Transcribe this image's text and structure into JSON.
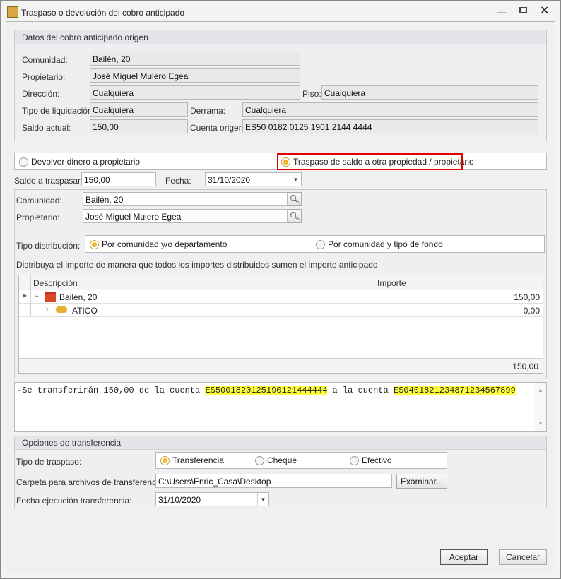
{
  "window": {
    "title": "Traspaso o devolución del cobro anticipado"
  },
  "origin": {
    "header": "Datos del cobro anticipado origen",
    "comunidad_label": "Comunidad:",
    "comunidad": "Bailén, 20",
    "propietario_label": "Propietario:",
    "propietario": "José Miguel Mulero Egea",
    "direccion_label": "Dirección:",
    "direccion": "Cualquiera",
    "piso_label": "Piso:",
    "piso": "Cualquiera",
    "tipo_liq_label": "Tipo de liquidación:",
    "tipo_liq": "Cualquiera",
    "derrama_label": "Derrama:",
    "derrama": "Cualquiera",
    "saldo_label": "Saldo actual:",
    "saldo": "150,00",
    "cuenta_label": "Cuenta origen:",
    "cuenta": "ES50 0182 0125 1901 2144 4444"
  },
  "mode": {
    "option1": "Devolver dinero a propietario",
    "option2": "Traspaso de saldo a otra propiedad / propietario",
    "selected": 2
  },
  "transfer": {
    "saldo_label": "Saldo a traspasar:",
    "saldo": "150,00",
    "fecha_label": "Fecha:",
    "fecha": "31/10/2020",
    "comunidad_label": "Comunidad:",
    "comunidad": "Bailén, 20",
    "propietario_label": "Propietario:",
    "propietario": "José Miguel Mulero Egea",
    "tipo_dist_label": "Tipo distribución:",
    "tipo_dist_opt1": "Por comunidad y/o departamento",
    "tipo_dist_opt2": "Por comunidad y tipo de fondo",
    "instructions": "Distribuya el importe de manera que todos los importes distribuidos sumen el importe anticipado"
  },
  "grid": {
    "columns": [
      "Descripción",
      "Importe"
    ],
    "rows": [
      {
        "descripcion": "Bailén, 20",
        "importe": "150,00"
      },
      {
        "descripcion": "ATICO",
        "importe": "0,00"
      }
    ],
    "total": "150,00"
  },
  "memo": {
    "prefix": "-Se transferirán 150,00 de la cuenta ",
    "from": "ES5001820125190121444444",
    "mid": " a la cuenta ",
    "to": "ES0401821234871234567899",
    "highlight": "#ffff3c"
  },
  "options": {
    "header": "Opciones de transferencia",
    "tipo_label": "Tipo de traspaso:",
    "tipo_opts": [
      "Transferencia",
      "Cheque",
      "Efectivo"
    ],
    "carpeta_label": "Carpeta para archivos de transferencia:",
    "carpeta": "C:\\Users\\Enric_Casa\\Desktop",
    "examinar": "Examinar...",
    "fecha_label": "Fecha ejecución transferencia:",
    "fecha": "31/10/2020"
  },
  "buttons": {
    "accept": "Aceptar",
    "cancel": "Cancelar"
  }
}
